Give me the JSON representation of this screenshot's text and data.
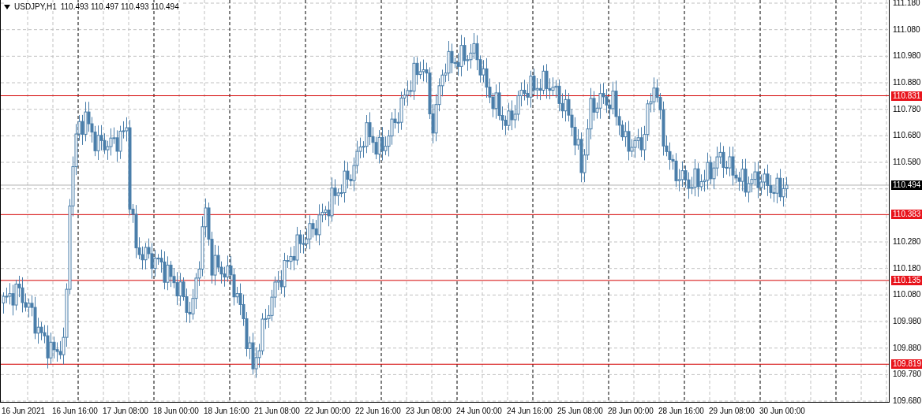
{
  "header": {
    "symbol": "USDJPY,H1",
    "ohlc": "110.493 110.497 110.493 110.494"
  },
  "price_axis": {
    "ticks": [
      "111.180",
      "111.080",
      "110.980",
      "110.880",
      "110.780",
      "110.680",
      "110.580",
      "110.280",
      "110.180",
      "110.080",
      "109.980",
      "109.880",
      "109.780",
      "109.680"
    ],
    "current_price": "110.494",
    "levels": [
      {
        "label": "110.831"
      },
      {
        "label": "110.383"
      },
      {
        "label": "110.135"
      },
      {
        "label": "109.819"
      }
    ]
  },
  "time_axis": {
    "labels": [
      "16 Jun 2021",
      "16 Jun 16:00",
      "17 Jun 08:00",
      "18 Jun 00:00",
      "18 Jun 16:00",
      "21 Jun 08:00",
      "22 Jun 00:00",
      "22 Jun 16:00",
      "23 Jun 08:00",
      "24 Jun 00:00",
      "24 Jun 16:00",
      "25 Jun 08:00",
      "28 Jun 00:00",
      "28 Jun 16:00",
      "29 Jun 08:00",
      "30 Jun 00:00"
    ]
  }
}
